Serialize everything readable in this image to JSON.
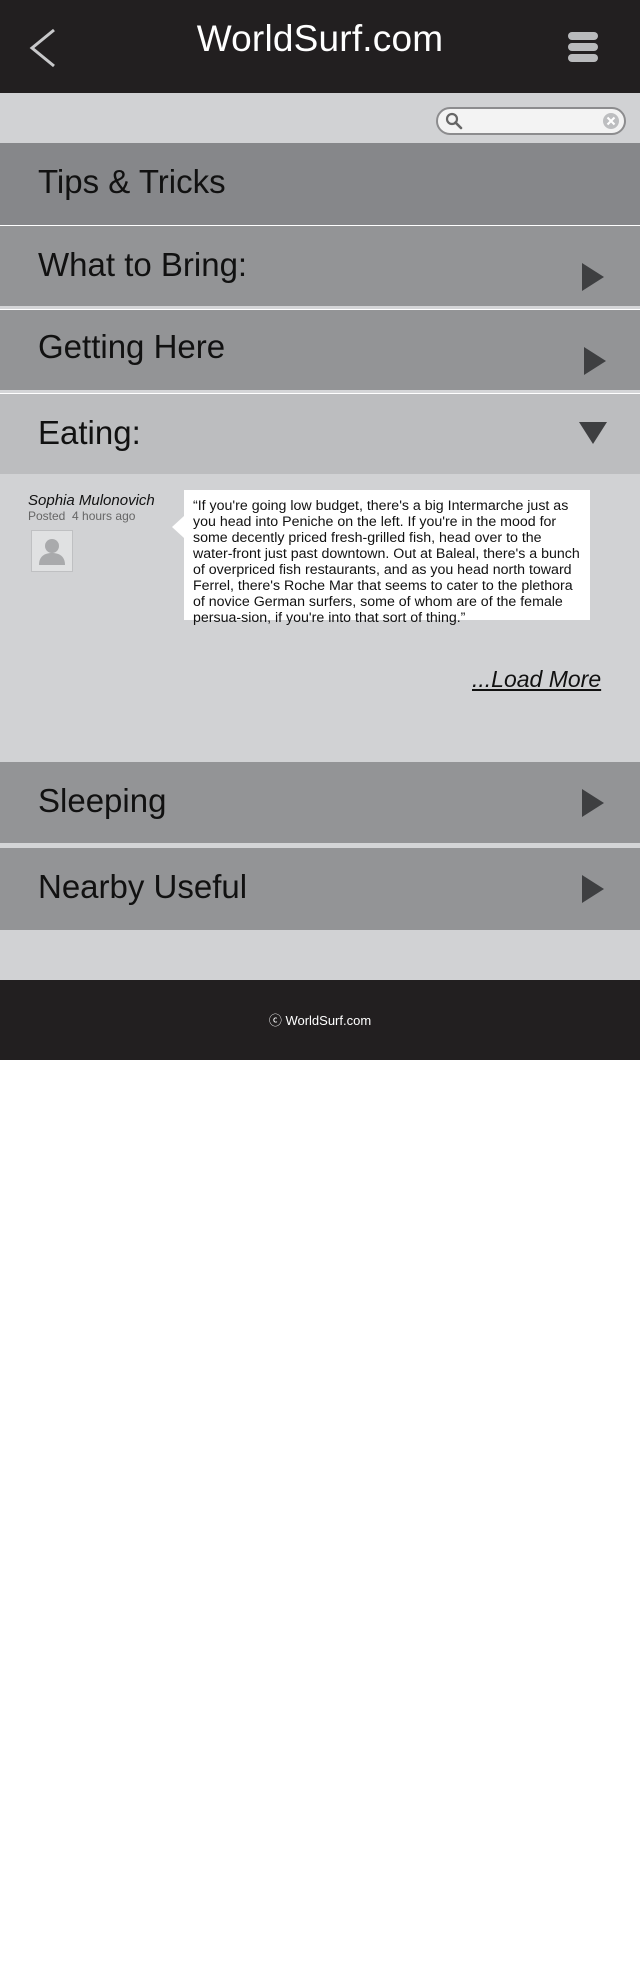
{
  "header": {
    "title": "WorldSurf.com",
    "back_icon": "chevron-left-icon",
    "menu_icon": "menu-icon"
  },
  "search": {
    "value": "",
    "placeholder": ""
  },
  "sections": {
    "tips": "Tips & Tricks",
    "what_to_bring": "What to Bring:",
    "getting_here": "Getting Here",
    "eating": "Eating:",
    "sleeping": "Sleeping",
    "nearby_useful": "Nearby Useful"
  },
  "post": {
    "author": "Sophia Mulonovich",
    "posted_label": "Posted",
    "posted_time": "4 hours ago",
    "text": "“If you're going low budget, there's a big Intermarche just as you head into Peniche on the left. If you're in the mood for some decently priced fresh-grilled fish, head over to the water-front just past downtown. Out at Baleal, there's a bunch of overpriced fish restaurants, and as you head north toward Ferrel, there's Roche Mar that seems to cater to the plethora of novice German surfers, some of whom are of the female persua-sion, if you're into that sort of thing.”"
  },
  "load_more": "...Load More",
  "footer": {
    "copyright": "ⓒ WorldSurf.com"
  }
}
